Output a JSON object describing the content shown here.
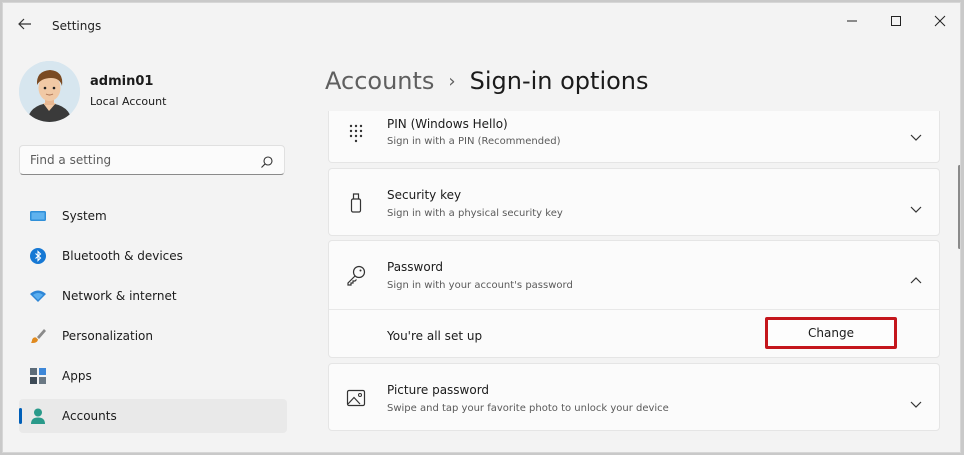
{
  "window": {
    "title": "Settings",
    "icons": {
      "back": "back-arrow-icon",
      "minimize": "minimize-icon",
      "maximize": "maximize-icon",
      "close": "close-icon"
    }
  },
  "profile": {
    "name": "admin01",
    "account_type": "Local Account"
  },
  "search": {
    "placeholder": "Find a setting",
    "icon": "search-icon"
  },
  "sidebar": {
    "items": [
      {
        "label": "System",
        "icon": "system-icon",
        "active": false
      },
      {
        "label": "Bluetooth & devices",
        "icon": "bluetooth-icon",
        "active": false
      },
      {
        "label": "Network & internet",
        "icon": "network-icon",
        "active": false
      },
      {
        "label": "Personalization",
        "icon": "brush-icon",
        "active": false
      },
      {
        "label": "Apps",
        "icon": "apps-icon",
        "active": false
      },
      {
        "label": "Accounts",
        "icon": "accounts-icon",
        "active": true
      }
    ]
  },
  "header": {
    "parent": "Accounts",
    "separator": "›",
    "current": "Sign-in options"
  },
  "options": [
    {
      "title": "PIN (Windows Hello)",
      "subtitle": "Sign in with a PIN (Recommended)",
      "icon": "keypad-icon",
      "expanded": false
    },
    {
      "title": "Security key",
      "subtitle": "Sign in with a physical security key",
      "icon": "usb-key-icon",
      "expanded": false
    },
    {
      "title": "Password",
      "subtitle": "Sign in with your account's password",
      "icon": "key-icon",
      "expanded": true,
      "detail": {
        "status": "You're all set up",
        "button": "Change"
      }
    },
    {
      "title": "Picture password",
      "subtitle": "Swipe and tap your favorite photo to unlock your device",
      "icon": "picture-icon",
      "expanded": false
    }
  ],
  "colors": {
    "accent": "#005fb8",
    "highlight_border": "#c4161c",
    "window_bg": "#f3f3f3",
    "card_bg": "#fbfbfb"
  }
}
